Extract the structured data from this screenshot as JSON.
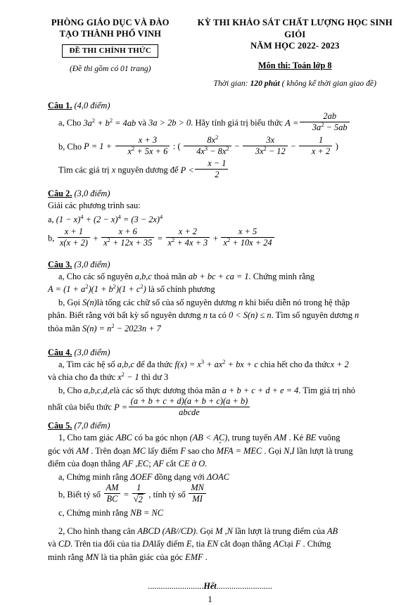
{
  "header": {
    "school_line1": "PHÒNG GIÁO DỤC VÀ ĐÀO",
    "school_line2": "TẠO THÀNH PHỐ VINH",
    "official_badge": "ĐỀ THI CHÍNH THỨC",
    "page_count_note": "(Đề thi gồm có 01 trang)",
    "exam_line1": "KỲ THI KHẢO SÁT CHẤT LƯỢNG HỌC SINH GIỎI",
    "exam_line2": "NĂM HỌC 2022- 2023",
    "subject": "Môn thi: Toán lớp 8",
    "duration_prefix": "Thời gian:",
    "duration_value": "120 phút",
    "duration_suffix": "( không kể thời gian giao đề)"
  },
  "questions": [
    {
      "label": "Câu 1.",
      "points": "(4,0 điểm)",
      "parts": {
        "a_prefix": "a, Cho",
        "a_eq1_lhs_3a": "3a",
        "a_eq1_b": "+ b",
        "a_eq1_rhs": "= 4ab",
        "a_and": "và",
        "a_cond": "3a > 2b > 0",
        "a_text": ". Hãy tính giá trị biểu thức",
        "a_A": "A =",
        "a_frac_num": "2ab",
        "a_frac_den_1": "3a",
        "a_frac_den_2": "− 5ab",
        "b_prefix": "b, Cho",
        "b_P": "P = 1 +",
        "b_f1_num": "x + 3",
        "b_f1_den": "x² + 5x + 6",
        "b_div": ": (",
        "b_f2_num": "8x²",
        "b_f2_den": "4x³ − 8x²",
        "b_minus1": "−",
        "b_f3_num": "3x",
        "b_f3_den": "3x² − 12",
        "b_minus2": "−",
        "b_f4_num": "1",
        "b_f4_den": "x + 2",
        "b_close": ")",
        "c_text1": "Tìm các giá trị",
        "c_x": "x",
        "c_text2": "nguyên dương để",
        "c_P": "P <",
        "c_f_num": "x − 1",
        "c_f_den": "2"
      }
    },
    {
      "label": "Câu 2.",
      "points": "(3,0 điểm)",
      "intro": "Giải các phương trình sau:",
      "parts": {
        "a_text": "a, (1 − x)⁴ + (2 − x)⁴ = (3 − 2x)⁴",
        "b_prefix": "b,",
        "b_f1_num": "x + 1",
        "b_f1_den": "x(x + 2)",
        "b_plus1": "+",
        "b_f2_num": "x + 6",
        "b_f2_den": "x² + 12x + 35",
        "b_eq": "=",
        "b_f3_num": "x + 2",
        "b_f3_den": "x² + 4x + 3",
        "b_plus2": "+",
        "b_f4_num": "x + 5",
        "b_f4_den": "x² + 10x + 24"
      }
    },
    {
      "label": "Câu 3.",
      "points": "(3,0 điểm)",
      "parts": {
        "a_line1": "a, Cho các số nguyên a,b,c thoả mãn ab + bc + ca = 1 . Chứng minh rằng",
        "a_line2": "A = (1 + a²)(1 + b²)(1 + c²) là số chính phương",
        "b_line1": "b, Gọi S(n)là tổng các chữ số của số nguyên dương n khi biểu diễn nó trong hệ thập",
        "b_line2": "phân. Biết rằng với bất kỳ số nguyên dương n ta có 0 < S(n) ≤ n . Tìm số nguyên dương n",
        "b_line3": "thỏa mãn S(n) = n² − 2023n + 7"
      }
    },
    {
      "label": "Câu 4.",
      "points": "(3,0 điểm)",
      "parts": {
        "a_line1": "a, Tìm các hệ số a,b,c để đa thức f(x) = x³ + ax² + bx + c chia hết cho đa thức x + 2",
        "a_line2": "và chia cho đa thức x² − 1 thì dư 3",
        "b_line1": "b, Cho a,b,c,d,elà các số thực dương thỏa mãn a + b + c + d + e = 4 . Tìm giá trị nhỏ",
        "b_line2_prefix": "nhất của biểu thức",
        "b_P": "P =",
        "b_num": "(a + b + c + d)(a + b + c)(a + b)",
        "b_den": "abcde"
      }
    },
    {
      "label": "Câu 5.",
      "points": "(7,0 điểm)",
      "parts": {
        "p1_line1": "1, Cho tam giác ABC có ba góc nhọn (AB < AC), trung tuyến AM . Kẻ BE vuông",
        "p1_line2": "góc với AM . Trên đoạn MC lấy điểm F sao cho MFA = MEC . Gọi N,I lần lượt là trung",
        "p1_line3": "điểm của đoạn thẳng AF,EC; AF cắt CE ở O.",
        "a_text": "a, Chứng minh rằng ΔOEF đồng dạng với ΔOAC",
        "b_prefix": "b, Biết tỷ số",
        "b_f1_num": "AM",
        "b_f1_den": "BC",
        "b_eq": "=",
        "b_f2_num": "1",
        "b_f2_den": "√2",
        "b_mid": ", tính tỷ số",
        "b_f3_num": "MN",
        "b_f3_den": "MI",
        "c_text": "c, Chứng minh rằng NB = NC",
        "p2_line1": "2, Cho hình thang cân ABCD (AB//CD). Gọi M,N lần lượt là trung điểm của AB",
        "p2_line2": "và CD. Trên tia đối của tia DAlấy điểm E, tia EN cắt đoạn thẳng ACtại F. Chứng",
        "p2_line3": "minh rằng MN là tia phân giác của góc EMF ."
      }
    }
  ],
  "footer": {
    "dots_left": "..........................",
    "end_word": "Hết",
    "dots_right": "..........................",
    "page_number": "1"
  }
}
